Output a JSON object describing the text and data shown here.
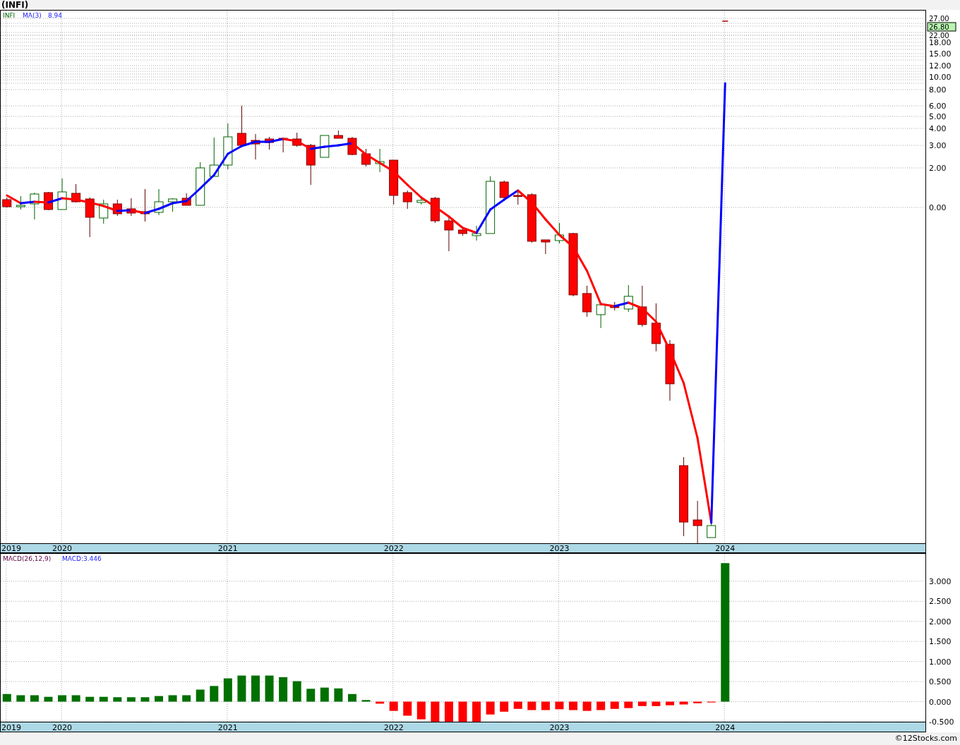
{
  "title": "(INFI)",
  "price_panel": {
    "legend": {
      "symbol": "INFI",
      "indicator": "MA(3)",
      "indicator_value": "8.94"
    },
    "y_axis_labels": [
      "27.00",
      "22.00",
      "18.00",
      "15.00",
      "12.00",
      "10.00",
      "8.00",
      "6.00",
      "5.00",
      "4.00",
      "3.00",
      "2.00",
      "0.00"
    ],
    "last_price": "26.80",
    "x_axis_labels": [
      "2019",
      "2020",
      "2021",
      "2022",
      "2023",
      "2024"
    ]
  },
  "macd_panel": {
    "legend": {
      "name": "MACD(26,12,9)",
      "value": "MACD:3.446"
    },
    "x_axis_labels": [
      "2019",
      "2020",
      "2021",
      "2022",
      "2023",
      "2024"
    ],
    "chart_data": {
      "type": "bar",
      "grid": true,
      "ylim": [
        -0.5,
        3.7
      ],
      "values": [
        0.19,
        0.16,
        0.16,
        0.12,
        0.16,
        0.16,
        0.12,
        0.12,
        0.11,
        0.11,
        0.11,
        0.14,
        0.16,
        0.16,
        0.3,
        0.39,
        0.58,
        0.65,
        0.65,
        0.65,
        0.61,
        0.51,
        0.32,
        0.35,
        0.33,
        0.19,
        0.04,
        -0.05,
        -0.23,
        -0.35,
        -0.44,
        -0.5,
        -0.5,
        -0.5,
        -0.5,
        -0.32,
        -0.25,
        -0.18,
        -0.21,
        -0.21,
        -0.19,
        -0.21,
        -0.23,
        -0.21,
        -0.18,
        -0.16,
        -0.11,
        -0.11,
        -0.09,
        -0.07,
        -0.04,
        -0.02,
        3.45,
        null,
        null,
        null,
        null,
        null,
        null,
        null,
        null,
        null,
        null,
        null,
        null,
        null,
        null
      ],
      "yticks": [
        {
          "value": 3,
          "label": "3.000"
        },
        {
          "value": 2.5,
          "label": "2.500"
        },
        {
          "value": 2,
          "label": "2.000"
        },
        {
          "value": 1.5,
          "label": "1.500"
        },
        {
          "value": 1,
          "label": "1.000"
        },
        {
          "value": 0.5,
          "label": "0.500"
        },
        {
          "value": 0,
          "label": "0.000"
        },
        {
          "value": -0.5,
          "label": "-0.500"
        }
      ]
    }
  },
  "footer": "©12Stocks.com"
}
